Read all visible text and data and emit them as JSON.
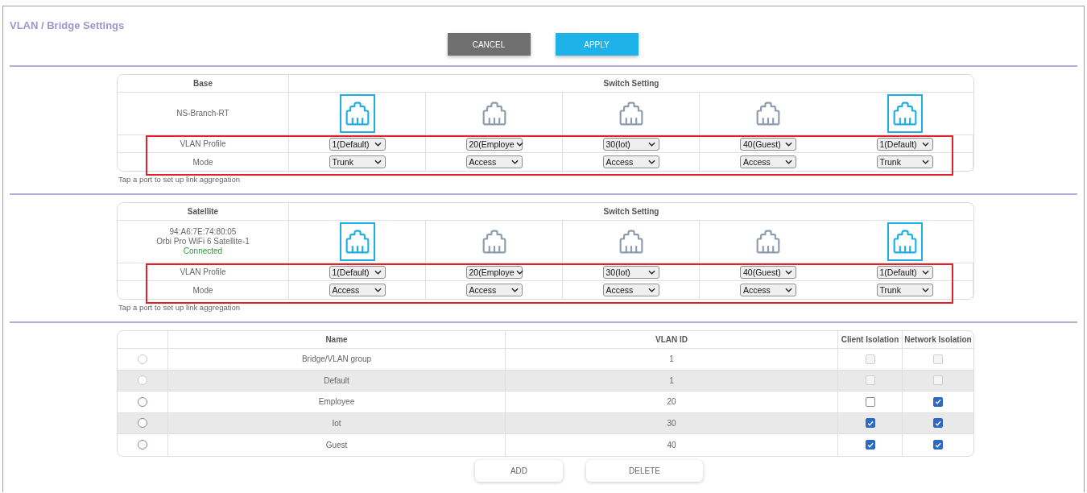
{
  "page_title": "VLAN / Bridge Settings",
  "buttons": [
    {
      "label": "CANCEL",
      "kind": "cancel"
    },
    {
      "label": "APPLY",
      "kind": "apply"
    }
  ],
  "switch_sections": [
    {
      "header": "Base",
      "setting_header": "Switch Setting",
      "highlighted": true,
      "device_lines": [
        {
          "text": "NS-Branch-RT",
          "kind": "name"
        }
      ],
      "profile_label": "VLAN Profile",
      "mode_label": "Mode",
      "ports": [
        {
          "selected": true,
          "vlan_profile": "1(Default)",
          "mode": "Trunk"
        },
        {
          "selected": false,
          "vlan_profile": "20(Employe",
          "mode": "Access"
        },
        {
          "selected": false,
          "vlan_profile": "30(Iot)",
          "mode": "Access"
        },
        {
          "selected": false,
          "vlan_profile": "40(Guest)",
          "mode": "Access"
        },
        {
          "selected": true,
          "vlan_profile": "1(Default)",
          "mode": "Trunk"
        }
      ],
      "note": "Tap a port to set up link aggregation"
    },
    {
      "header": "Satellite",
      "setting_header": "Switch Setting",
      "highlighted": true,
      "device_lines": [
        {
          "text": "94:A6:7E:74:80:05",
          "kind": "name"
        },
        {
          "text": "Orbi Pro WiFi 6 Satellite-1",
          "kind": "name"
        },
        {
          "text": "Connected",
          "kind": "status"
        }
      ],
      "profile_label": "VLAN Profile",
      "mode_label": "Mode",
      "ports": [
        {
          "selected": true,
          "vlan_profile": "1(Default)",
          "mode": "Access"
        },
        {
          "selected": false,
          "vlan_profile": "20(Employe",
          "mode": "Access"
        },
        {
          "selected": false,
          "vlan_profile": "30(Iot)",
          "mode": "Access"
        },
        {
          "selected": false,
          "vlan_profile": "40(Guest)",
          "mode": "Access"
        },
        {
          "selected": true,
          "vlan_profile": "1(Default)",
          "mode": "Trunk"
        }
      ],
      "note": "Tap a port to set up link aggregation"
    }
  ],
  "vlan_table": {
    "columns": [
      "Name",
      "VLAN ID",
      "Client Isolation",
      "Network Isolation"
    ],
    "rows": [
      {
        "selected": false,
        "disabled": true,
        "name": "Bridge/VLAN group",
        "vlan_id": "1",
        "client_isolation": false,
        "network_isolation": false
      },
      {
        "selected": false,
        "disabled": true,
        "name": "Default",
        "vlan_id": "1",
        "client_isolation": false,
        "network_isolation": false
      },
      {
        "selected": false,
        "disabled": false,
        "name": "Employee",
        "vlan_id": "20",
        "client_isolation": false,
        "network_isolation": true
      },
      {
        "selected": false,
        "disabled": false,
        "name": "Iot",
        "vlan_id": "30",
        "client_isolation": true,
        "network_isolation": true
      },
      {
        "selected": false,
        "disabled": false,
        "name": "Guest",
        "vlan_id": "40",
        "client_isolation": true,
        "network_isolation": true
      }
    ]
  },
  "actions": [
    "ADD",
    "DELETE"
  ]
}
